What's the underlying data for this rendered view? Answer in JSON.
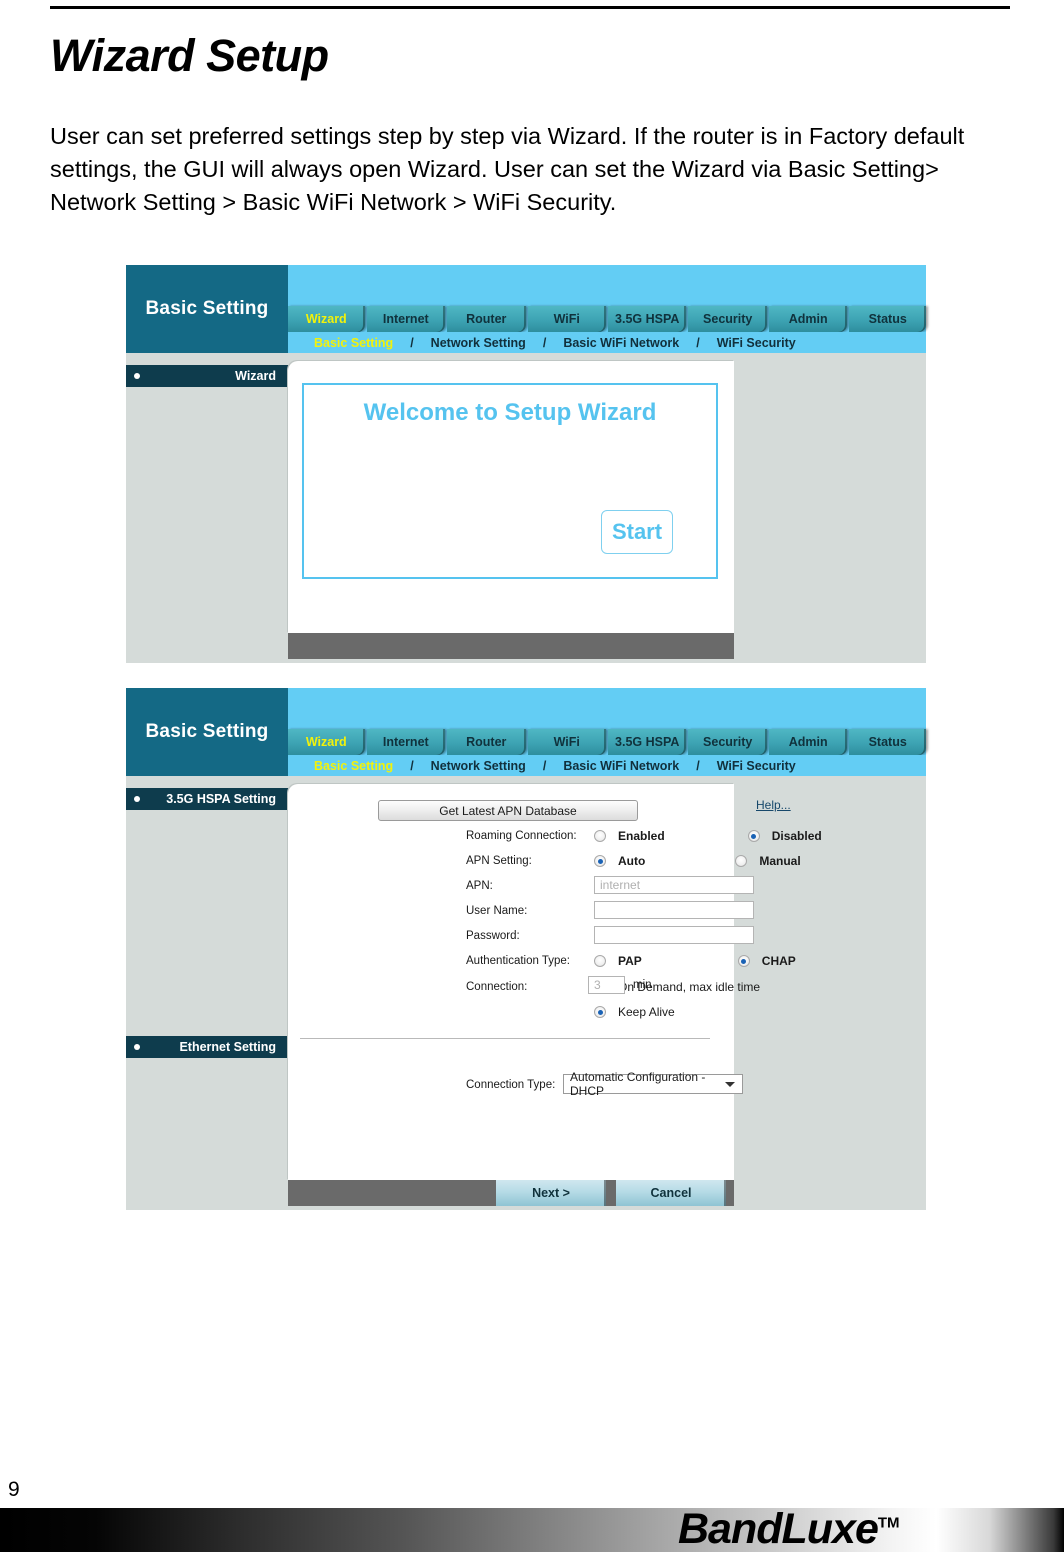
{
  "document": {
    "title": "Wizard Setup",
    "paragraph": "User can set preferred settings step by step via Wizard. If the router is in Factory default settings, the GUI will always open Wizard. User can set the Wizard via Basic Setting> Network Setting > Basic WiFi Network > WiFi Security.",
    "page_number": "9",
    "footer_brand": "BandLuxe",
    "footer_trademark": "TM"
  },
  "ui_common": {
    "brand_label": "Basic Setting",
    "tabs": [
      {
        "label": "Wizard",
        "active": true
      },
      {
        "label": "Internet",
        "active": false
      },
      {
        "label": "Router",
        "active": false
      },
      {
        "label": "WiFi",
        "active": false
      },
      {
        "label": "3.5G HSPA",
        "active": false
      },
      {
        "label": "Security",
        "active": false
      },
      {
        "label": "Admin",
        "active": false
      },
      {
        "label": "Status",
        "active": false
      }
    ],
    "breadcrumb": [
      {
        "label": "Basic Setting",
        "active": true
      },
      {
        "label": "Network Setting",
        "active": false
      },
      {
        "label": "Basic WiFi Network",
        "active": false
      },
      {
        "label": "WiFi Security",
        "active": false
      }
    ],
    "breadcrumb_separator": "/",
    "colors": {
      "brand_panel": "#146985",
      "header_blue": "#63cdf4",
      "tab_teal": "#3da3b3",
      "active_tab_text": "#f2f20b",
      "sidebar_item": "#0e3c4d",
      "body_gray": "#d5dbd9",
      "accent_cyan": "#55c3ef",
      "action_bar": "#6a6a6a"
    }
  },
  "screenshot_wizard": {
    "sidebar_items": [
      {
        "label": "Wizard"
      }
    ],
    "welcome_title": "Welcome to Setup Wizard",
    "start_button": "Start"
  },
  "screenshot_hspa": {
    "sidebar_items": [
      {
        "label": "3.5G HSPA Setting"
      },
      {
        "label": "Ethernet Setting"
      }
    ],
    "help_link": "Help...",
    "get_apn_button": "Get Latest APN Database",
    "fields": {
      "roaming_label": "Roaming Connection:",
      "roaming_option_1": "Enabled",
      "roaming_option_1_selected": false,
      "roaming_option_2": "Disabled",
      "roaming_option_2_selected": true,
      "apn_setting_label": "APN Setting:",
      "apn_setting_option_1": "Auto",
      "apn_setting_option_1_selected": true,
      "apn_setting_option_2": "Manual",
      "apn_setting_option_2_selected": false,
      "apn_label": "APN:",
      "apn_value": "internet",
      "username_label": "User Name:",
      "username_value": "",
      "password_label": "Password:",
      "password_value": "",
      "auth_label": "Authentication Type:",
      "auth_option_1": "PAP",
      "auth_option_1_selected": false,
      "auth_option_2": "CHAP",
      "auth_option_2_selected": true,
      "connection_label": "Connection:",
      "connection_option_1": "On Demand, max idle time",
      "connection_option_1_selected": false,
      "idle_time_value": "3",
      "idle_time_unit": "min",
      "connection_option_2": "Keep Alive",
      "connection_option_2_selected": true,
      "connection_type_label": "Connection Type:",
      "connection_type_value": "Automatic Configuration - DHCP"
    },
    "buttons": {
      "next": "Next >",
      "cancel": "Cancel"
    }
  }
}
